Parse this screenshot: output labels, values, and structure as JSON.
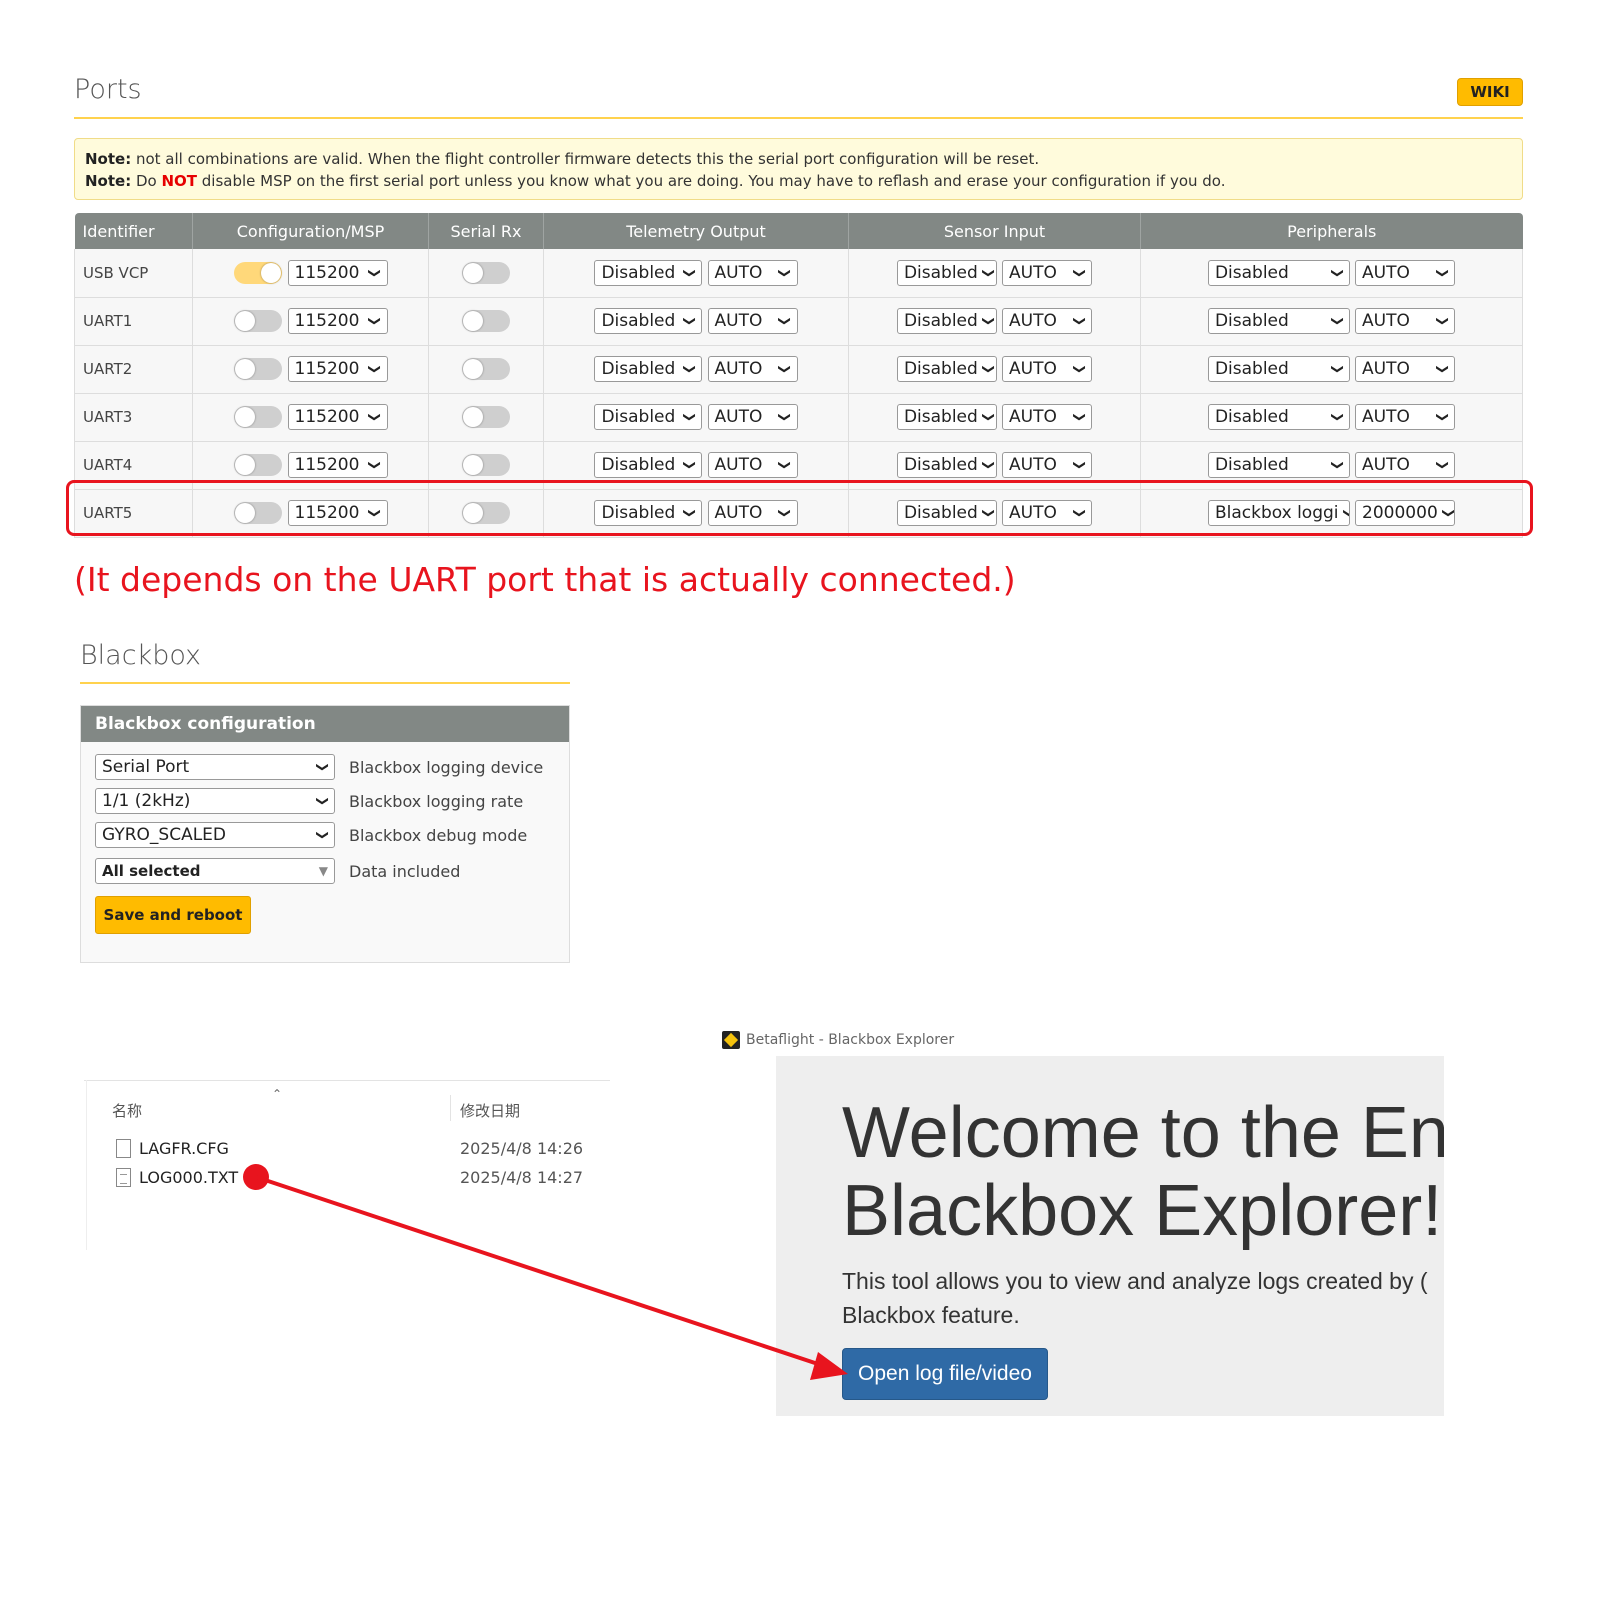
{
  "ports": {
    "title": "Ports",
    "wiki_label": "WIKI",
    "note_line1_bold": "Note:",
    "note_line1": " not all combinations are valid. When the flight controller firmware detects this the serial port configuration will be reset.",
    "note_line2_bold": "Note:",
    "note_line2_a": " Do ",
    "note_line2_not": "NOT",
    "note_line2_b": " disable MSP on the first serial port unless you know what you are doing. You may have to reflash and erase your configuration if you do.",
    "headers": [
      "Identifier",
      "Configuration/MSP",
      "Serial Rx",
      "Telemetry Output",
      "Sensor Input",
      "Peripherals"
    ],
    "rows": [
      {
        "id": "USB VCP",
        "msp_on": true,
        "msp_baud": "115200",
        "rx_on": false,
        "telem": "Disabled",
        "telem_baud": "AUTO",
        "sensor": "Disabled",
        "sensor_baud": "AUTO",
        "periph": "Disabled",
        "periph_baud": "AUTO"
      },
      {
        "id": "UART1",
        "msp_on": false,
        "msp_baud": "115200",
        "rx_on": false,
        "telem": "Disabled",
        "telem_baud": "AUTO",
        "sensor": "Disabled",
        "sensor_baud": "AUTO",
        "periph": "Disabled",
        "periph_baud": "AUTO"
      },
      {
        "id": "UART2",
        "msp_on": false,
        "msp_baud": "115200",
        "rx_on": false,
        "telem": "Disabled",
        "telem_baud": "AUTO",
        "sensor": "Disabled",
        "sensor_baud": "AUTO",
        "periph": "Disabled",
        "periph_baud": "AUTO"
      },
      {
        "id": "UART3",
        "msp_on": false,
        "msp_baud": "115200",
        "rx_on": false,
        "telem": "Disabled",
        "telem_baud": "AUTO",
        "sensor": "Disabled",
        "sensor_baud": "AUTO",
        "periph": "Disabled",
        "periph_baud": "AUTO"
      },
      {
        "id": "UART4",
        "msp_on": false,
        "msp_baud": "115200",
        "rx_on": false,
        "telem": "Disabled",
        "telem_baud": "AUTO",
        "sensor": "Disabled",
        "sensor_baud": "AUTO",
        "periph": "Disabled",
        "periph_baud": "AUTO"
      },
      {
        "id": "UART5",
        "msp_on": false,
        "msp_baud": "115200",
        "rx_on": false,
        "telem": "Disabled",
        "telem_baud": "AUTO",
        "sensor": "Disabled",
        "sensor_baud": "AUTO",
        "periph": "Blackbox loggi",
        "periph_baud": "2000000"
      }
    ],
    "annotation": "(It depends on the UART port that is actually connected.)",
    "highlight_color": "#e8141e"
  },
  "blackbox": {
    "title": "Blackbox",
    "panel_title": "Blackbox configuration",
    "device_value": "Serial Port",
    "device_label": "Blackbox logging device",
    "rate_value": "1/1 (2kHz)",
    "rate_label": "Blackbox logging rate",
    "debug_value": "GYRO_SCALED",
    "debug_label": "Blackbox debug mode",
    "data_value": "All selected",
    "data_label": "Data included",
    "save_label": "Save and reboot",
    "accent": "#ffbb00"
  },
  "file_explorer": {
    "col_name": "名称",
    "col_date": "修改日期",
    "files": [
      {
        "name": "LAGFR.CFG",
        "date": "2025/4/8 14:26",
        "icon": "blank-file-icon"
      },
      {
        "name": "LOG000.TXT",
        "date": "2025/4/8 14:27",
        "icon": "text-file-icon"
      }
    ]
  },
  "explorer": {
    "window_title": "Betaflight - Blackbox Explorer",
    "welcome_line1": "Welcome to the En",
    "welcome_line2": "Blackbox Explorer!",
    "desc_line1": "This tool allows you to view and analyze logs created by (",
    "desc_line2": "Blackbox feature.",
    "open_label": "Open log file/video",
    "button_color": "#2f6aa6"
  }
}
